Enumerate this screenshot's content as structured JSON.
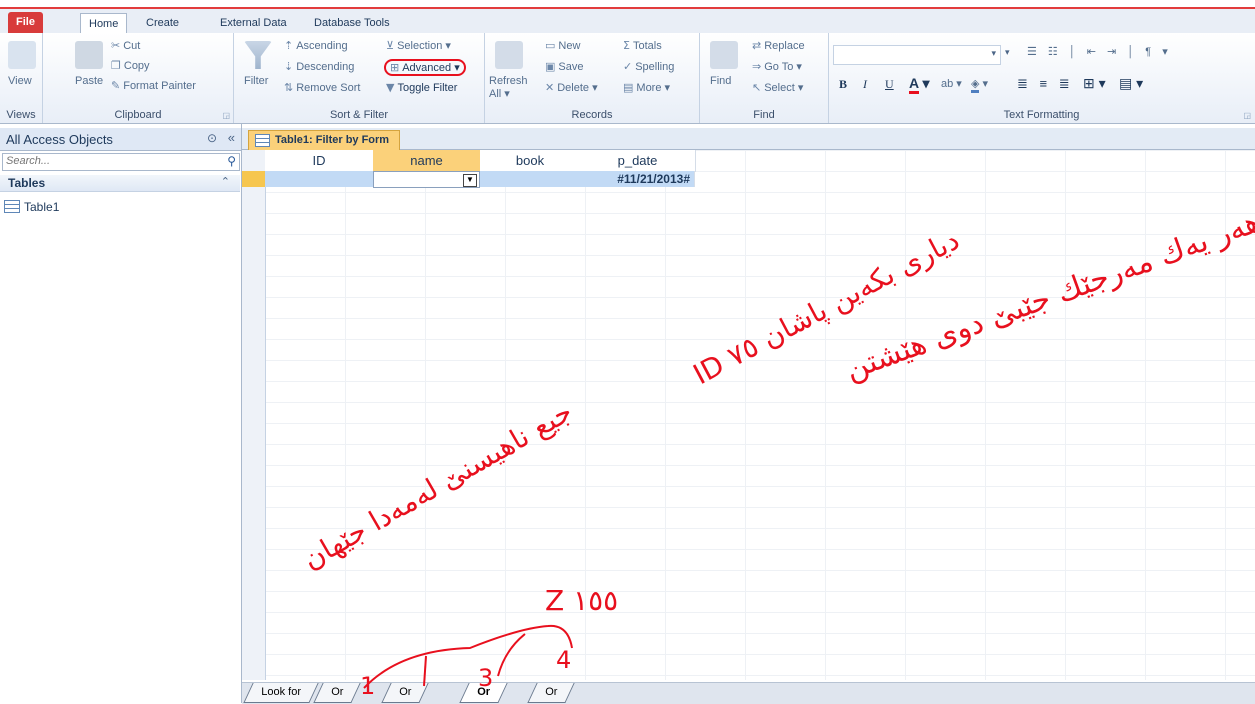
{
  "ribbon": {
    "tabs": [
      "File",
      "Home",
      "Create",
      "External Data",
      "Database Tools"
    ],
    "active_tab": "Home",
    "groups": {
      "views": {
        "label": "Views",
        "view": "View"
      },
      "clipboard": {
        "label": "Clipboard",
        "paste": "Paste",
        "cut": "Cut",
        "copy": "Copy",
        "format_painter": "Format Painter"
      },
      "sort_filter": {
        "label": "Sort & Filter",
        "filter": "Filter",
        "ascending": "Ascending",
        "descending": "Descending",
        "remove_sort": "Remove Sort",
        "selection": "Selection",
        "advanced": "Advanced",
        "toggle_filter": "Toggle Filter"
      },
      "records": {
        "label": "Records",
        "refresh": "Refresh",
        "refresh_sub": "All",
        "new": "New",
        "save": "Save",
        "delete": "Delete",
        "totals": "Totals",
        "spelling": "Spelling",
        "more": "More"
      },
      "find": {
        "label": "Find",
        "find": "Find",
        "replace": "Replace",
        "goto": "Go To",
        "select": "Select"
      },
      "text_formatting": {
        "label": "Text Formatting"
      }
    }
  },
  "nav": {
    "title": "All Access Objects",
    "search_placeholder": "Search...",
    "section": "Tables",
    "items": [
      "Table1"
    ]
  },
  "document": {
    "tab_title": "Table1: Filter by Form",
    "columns": [
      "ID",
      "name",
      "book",
      "p_date"
    ],
    "filter_row": {
      "p_date": "#11/21/2013#"
    },
    "bottom_tabs": [
      "Look for",
      "Or",
      "Or",
      "Or",
      "Or"
    ],
    "active_bottom_tab": 3
  },
  "annotations": {
    "ink_color": "#e8101e",
    "texts": [
      "وانە هەر یەك مەرجێك جێبێ دوی هێشتن",
      "ID دیاری بکەین پاشان ٧٥",
      "جیع ناهیسنێ لەمەدا جێهان",
      "Z ١٥٥",
      "1",
      "3",
      "4"
    ]
  }
}
